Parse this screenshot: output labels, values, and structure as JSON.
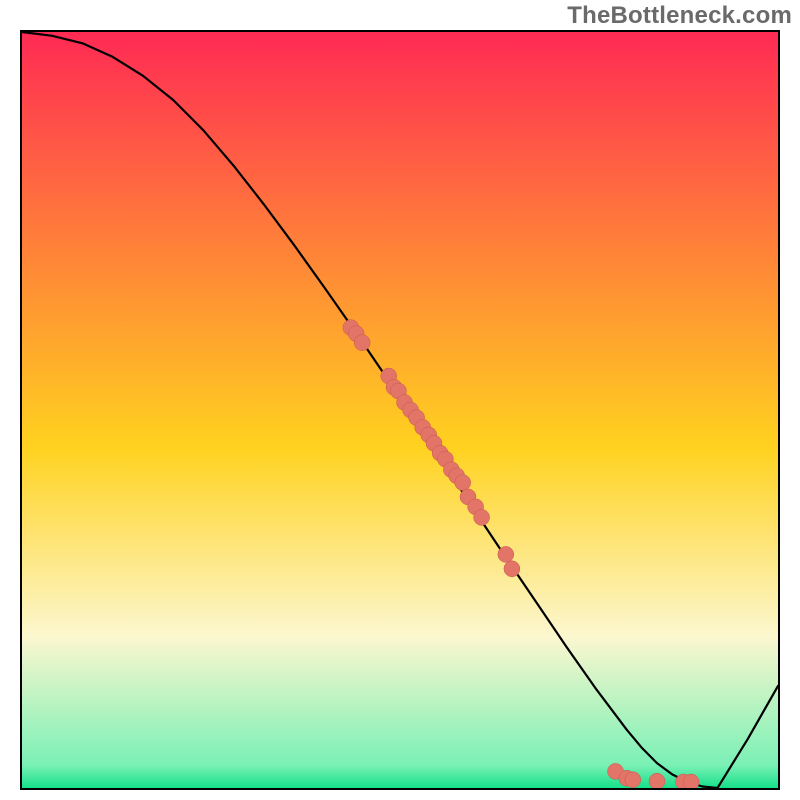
{
  "watermark": "TheBottleneck.com",
  "colors": {
    "gradient_top": "#ff2a54",
    "gradient_mid": "#ffd21f",
    "gradient_cream": "#fcf7cf",
    "gradient_green": "#15e08a",
    "line": "#000000",
    "dot_fill": "#e27468",
    "dot_stroke": "#c7584c",
    "frame": "#000000"
  },
  "chart_data": {
    "type": "line",
    "title": "",
    "xlabel": "",
    "ylabel": "",
    "xlim": [
      0,
      100
    ],
    "ylim": [
      0,
      100
    ],
    "series": [
      {
        "name": "curve",
        "x": [
          0,
          4,
          8,
          12,
          16,
          20,
          24,
          28,
          32,
          36,
          40,
          44,
          48,
          52,
          56,
          60,
          64,
          68,
          72,
          76,
          80,
          82,
          84,
          86,
          88,
          90,
          92,
          96,
          100
        ],
        "y": [
          100,
          99.5,
          98.5,
          96.7,
          94.2,
          91,
          87,
          82.3,
          77.2,
          71.8,
          66.2,
          60.5,
          54.6,
          48.6,
          42.6,
          36.5,
          30.5,
          24.6,
          18.7,
          13,
          7.7,
          5.3,
          3.3,
          1.8,
          0.8,
          0.2,
          0,
          6.5,
          13.5
        ]
      }
    ],
    "scatter": [
      {
        "x": 43.5,
        "y": 60.9
      },
      {
        "x": 44.2,
        "y": 60.1
      },
      {
        "x": 45.0,
        "y": 58.9
      },
      {
        "x": 48.5,
        "y": 54.5
      },
      {
        "x": 49.2,
        "y": 53.0
      },
      {
        "x": 49.8,
        "y": 52.5
      },
      {
        "x": 50.6,
        "y": 51.0
      },
      {
        "x": 51.4,
        "y": 50.0
      },
      {
        "x": 52.2,
        "y": 49.0
      },
      {
        "x": 53.0,
        "y": 47.7
      },
      {
        "x": 53.8,
        "y": 46.7
      },
      {
        "x": 54.5,
        "y": 45.6
      },
      {
        "x": 55.3,
        "y": 44.3
      },
      {
        "x": 56.0,
        "y": 43.5
      },
      {
        "x": 56.8,
        "y": 42.1
      },
      {
        "x": 57.5,
        "y": 41.3
      },
      {
        "x": 58.3,
        "y": 40.4
      },
      {
        "x": 59.0,
        "y": 38.5
      },
      {
        "x": 60.0,
        "y": 37.2
      },
      {
        "x": 60.8,
        "y": 35.8
      },
      {
        "x": 64.0,
        "y": 30.9
      },
      {
        "x": 64.8,
        "y": 29.0
      },
      {
        "x": 78.5,
        "y": 2.2
      },
      {
        "x": 80.0,
        "y": 1.3
      },
      {
        "x": 80.8,
        "y": 1.1
      },
      {
        "x": 84.0,
        "y": 0.9
      },
      {
        "x": 87.5,
        "y": 0.8
      },
      {
        "x": 88.5,
        "y": 0.8
      }
    ]
  }
}
